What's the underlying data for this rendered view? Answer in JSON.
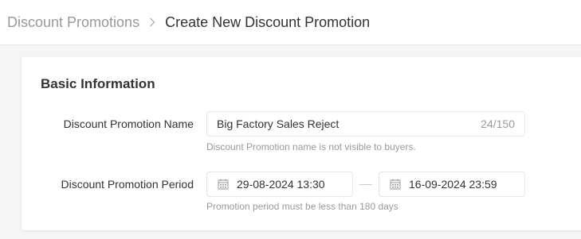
{
  "breadcrumb": {
    "parent": "Discount Promotions",
    "current": "Create New Discount Promotion"
  },
  "section": {
    "title": "Basic Information"
  },
  "form": {
    "name_label": "Discount Promotion Name",
    "name_value": "Big Factory Sales Reject",
    "name_counter": "24/150",
    "name_help": "Discount Promotion name is not visible to buyers.",
    "period_label": "Discount Promotion Period",
    "start_date": "29-08-2024 13:30",
    "end_date": "16-09-2024 23:59",
    "period_help": "Promotion period must be less than 180 days"
  },
  "icons": {
    "breadcrumb_separator": "chevron-right-icon",
    "date_picker": "calendar-icon"
  },
  "colors": {
    "text_primary": "#333333",
    "text_muted": "#999999",
    "border": "#e5e5e5",
    "page_bg": "#f5f5f5"
  }
}
